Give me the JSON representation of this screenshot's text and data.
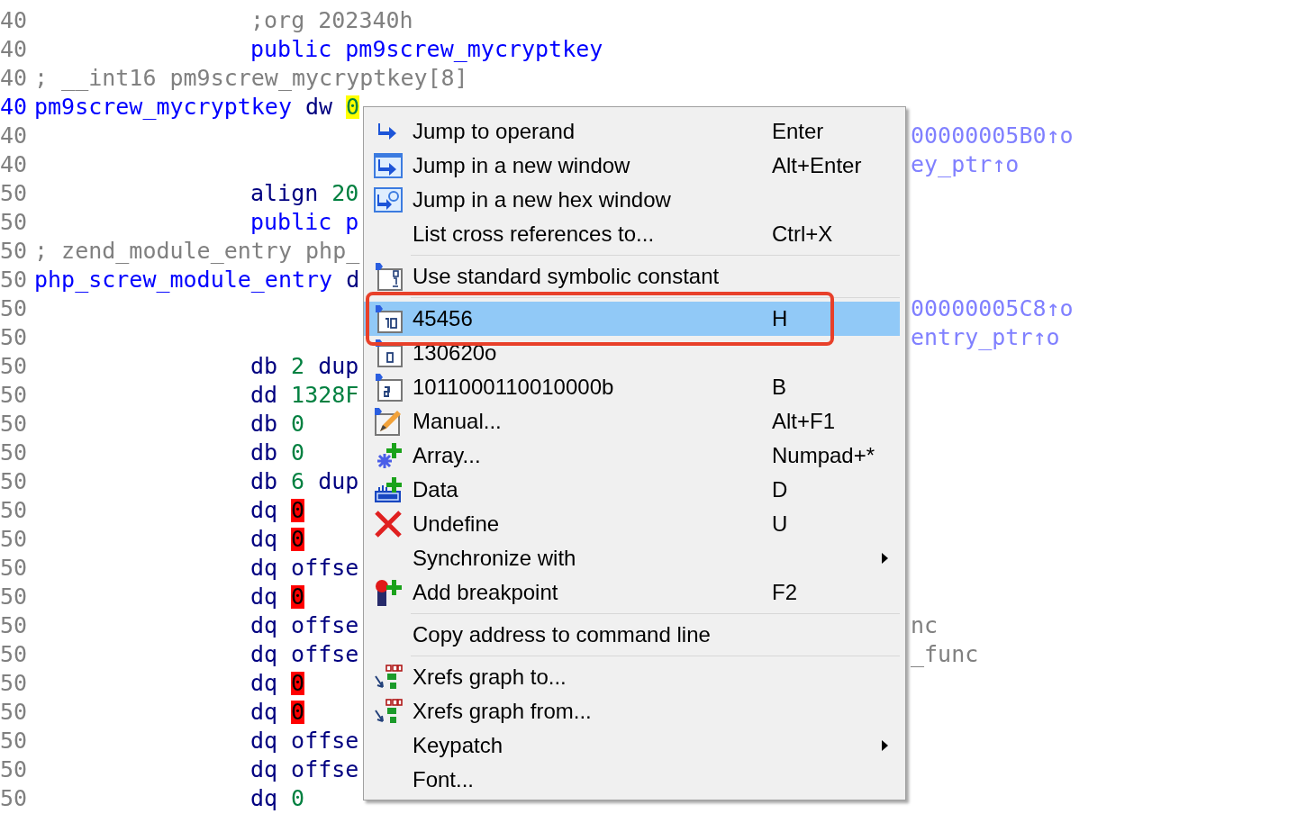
{
  "listing": {
    "rows": [
      {
        "address": "40",
        "current": false,
        "operation": [
          {
            "kind": "comment",
            "text": ";org 202340h"
          }
        ]
      },
      {
        "address": "40",
        "current": false,
        "operation": [
          {
            "kind": "name",
            "text": "public"
          },
          {
            "kind": "name",
            "text": "pm9screw_mycryptkey"
          }
        ]
      },
      {
        "address": "40",
        "current": false,
        "label": [
          {
            "kind": "comment",
            "text": "; __int16 pm9screw_mycryptkey[8]"
          }
        ]
      },
      {
        "address": "40",
        "current": true,
        "label": [
          {
            "kind": "name",
            "text": "pm9screw_mycryptkey"
          },
          {
            "kind": "keyword",
            "text": "dw"
          },
          {
            "kind": "highlight",
            "text": "0"
          }
        ]
      },
      {
        "address": "40",
        "current": false,
        "xref": [
          {
            "kind": "xref",
            "text": "00000005B0↑o"
          }
        ]
      },
      {
        "address": "40",
        "current": false,
        "xref": [
          {
            "kind": "xref",
            "text": "ey_ptr↑o"
          }
        ]
      },
      {
        "address": "50",
        "current": false,
        "operation": [
          {
            "kind": "keyword",
            "text": "align"
          },
          {
            "kind": "number",
            "text": "20"
          }
        ]
      },
      {
        "address": "50",
        "current": false,
        "operation": [
          {
            "kind": "name",
            "text": "public"
          },
          {
            "kind": "name",
            "text": "p"
          }
        ]
      },
      {
        "address": "50",
        "current": false,
        "label": [
          {
            "kind": "comment",
            "text": "; zend_module_entry php_"
          }
        ]
      },
      {
        "address": "50",
        "current": false,
        "label": [
          {
            "kind": "name",
            "text": "php_screw_module_entry"
          },
          {
            "kind": "keyword",
            "text": "d"
          }
        ]
      },
      {
        "address": "50",
        "current": false,
        "xref": [
          {
            "kind": "xref",
            "text": "00000005C8↑o"
          }
        ]
      },
      {
        "address": "50",
        "current": false,
        "xref": [
          {
            "kind": "xref",
            "text": "entry_ptr↑o"
          }
        ]
      },
      {
        "address": "50",
        "current": false,
        "operation": [
          {
            "kind": "keyword",
            "text": "db"
          },
          {
            "kind": "number",
            "text": "2"
          },
          {
            "kind": "keyword",
            "text": "dup"
          }
        ]
      },
      {
        "address": "50",
        "current": false,
        "operation": [
          {
            "kind": "keyword",
            "text": "dd"
          },
          {
            "kind": "number",
            "text": "1328F"
          }
        ]
      },
      {
        "address": "50",
        "current": false,
        "operation": [
          {
            "kind": "keyword",
            "text": "db"
          },
          {
            "kind": "number",
            "text": "0"
          }
        ]
      },
      {
        "address": "50",
        "current": false,
        "operation": [
          {
            "kind": "keyword",
            "text": "db"
          },
          {
            "kind": "number",
            "text": "0"
          }
        ]
      },
      {
        "address": "50",
        "current": false,
        "operation": [
          {
            "kind": "keyword",
            "text": "db"
          },
          {
            "kind": "number",
            "text": "6"
          },
          {
            "kind": "keyword",
            "text": "dup"
          }
        ]
      },
      {
        "address": "50",
        "current": false,
        "operation": [
          {
            "kind": "keyword",
            "text": "dq"
          },
          {
            "kind": "error",
            "text": "0"
          }
        ]
      },
      {
        "address": "50",
        "current": false,
        "operation": [
          {
            "kind": "keyword",
            "text": "dq"
          },
          {
            "kind": "error",
            "text": "0"
          }
        ]
      },
      {
        "address": "50",
        "current": false,
        "operation": [
          {
            "kind": "keyword",
            "text": "dq"
          },
          {
            "kind": "keyword",
            "text": "offse"
          }
        ]
      },
      {
        "address": "50",
        "current": false,
        "operation": [
          {
            "kind": "keyword",
            "text": "dq"
          },
          {
            "kind": "error",
            "text": "0"
          }
        ]
      },
      {
        "address": "50",
        "current": false,
        "operation": [
          {
            "kind": "keyword",
            "text": "dq"
          },
          {
            "kind": "keyword",
            "text": "offse"
          }
        ],
        "xref": [
          {
            "kind": "comment",
            "text": "nc"
          }
        ]
      },
      {
        "address": "50",
        "current": false,
        "operation": [
          {
            "kind": "keyword",
            "text": "dq"
          },
          {
            "kind": "keyword",
            "text": "offse"
          }
        ],
        "xref": [
          {
            "kind": "comment",
            "text": "_func"
          }
        ]
      },
      {
        "address": "50",
        "current": false,
        "operation": [
          {
            "kind": "keyword",
            "text": "dq"
          },
          {
            "kind": "error",
            "text": "0"
          }
        ]
      },
      {
        "address": "50",
        "current": false,
        "operation": [
          {
            "kind": "keyword",
            "text": "dq"
          },
          {
            "kind": "error",
            "text": "0"
          }
        ]
      },
      {
        "address": "50",
        "current": false,
        "operation": [
          {
            "kind": "keyword",
            "text": "dq"
          },
          {
            "kind": "keyword",
            "text": "offse"
          }
        ]
      },
      {
        "address": "50",
        "current": false,
        "operation": [
          {
            "kind": "keyword",
            "text": "dq"
          },
          {
            "kind": "keyword",
            "text": "offse"
          }
        ]
      },
      {
        "address": "50",
        "current": false,
        "operation": [
          {
            "kind": "keyword",
            "text": "dq"
          },
          {
            "kind": "number",
            "text": "0"
          }
        ]
      }
    ]
  },
  "context_menu": {
    "items": [
      {
        "kind": "jump",
        "label": "Jump to operand",
        "shortcut": "Enter",
        "selected": false,
        "submenu": false
      },
      {
        "kind": "jump-window",
        "label": "Jump in a new window",
        "shortcut": "Alt+Enter",
        "selected": false,
        "submenu": false
      },
      {
        "kind": "jump-hex",
        "label": "Jump in a new hex window",
        "selected": false,
        "submenu": false
      },
      {
        "kind": "plain",
        "label": "List cross references to...",
        "shortcut": "Ctrl+X",
        "selected": false,
        "submenu": false
      },
      {
        "kind": "separator"
      },
      {
        "kind": "symbolic",
        "label": "Use standard symbolic constant",
        "selected": false,
        "submenu": false
      },
      {
        "kind": "separator"
      },
      {
        "kind": "decimal",
        "label": "45456",
        "shortcut": "H",
        "selected": true,
        "submenu": false
      },
      {
        "kind": "octal",
        "label": "130620o",
        "selected": false,
        "submenu": false
      },
      {
        "kind": "binary",
        "label": "1011000110010000b",
        "shortcut": "B",
        "selected": false,
        "submenu": false
      },
      {
        "kind": "manual",
        "label": "Manual...",
        "shortcut": "Alt+F1",
        "selected": false,
        "submenu": false
      },
      {
        "kind": "array",
        "label": "Array...",
        "shortcut": "Numpad+*",
        "selected": false,
        "submenu": false
      },
      {
        "kind": "data",
        "label": "Data",
        "shortcut": "D",
        "selected": false,
        "submenu": false
      },
      {
        "kind": "undefine",
        "label": "Undefine",
        "shortcut": "U",
        "selected": false,
        "submenu": false
      },
      {
        "kind": "plain",
        "label": "Synchronize with",
        "selected": false,
        "submenu": true
      },
      {
        "kind": "breakpoint",
        "label": "Add breakpoint",
        "shortcut": "F2",
        "selected": false,
        "submenu": false
      },
      {
        "kind": "separator"
      },
      {
        "kind": "plain",
        "label": "Copy address to command line",
        "selected": false,
        "submenu": false
      },
      {
        "kind": "separator"
      },
      {
        "kind": "xrefs-to",
        "label": "Xrefs graph to...",
        "selected": false,
        "submenu": false
      },
      {
        "kind": "xrefs-from",
        "label": "Xrefs graph from...",
        "selected": false,
        "submenu": false
      },
      {
        "kind": "plain",
        "label": "Keypatch",
        "selected": false,
        "submenu": true
      },
      {
        "kind": "plain",
        "label": "Font...",
        "selected": false,
        "submenu": false
      }
    ]
  }
}
